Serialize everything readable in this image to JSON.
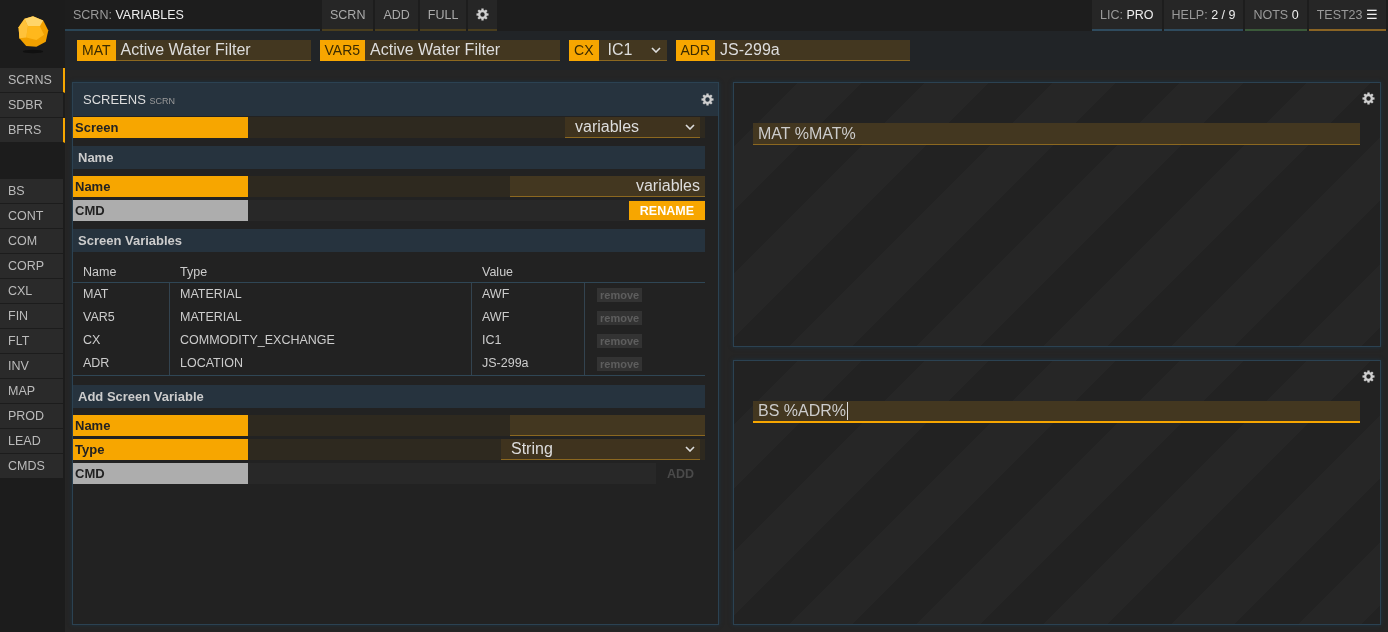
{
  "top_bar": {
    "screen_label": "SCRN:",
    "screen_name": "VARIABLES",
    "buttons": [
      {
        "label": "SCRN"
      },
      {
        "label": "ADD"
      },
      {
        "label": "FULL"
      }
    ],
    "status": [
      {
        "label": "LIC:",
        "value": "PRO",
        "color": "#2f4b5e"
      },
      {
        "label": "HELP:",
        "value": "2 / 9",
        "color": "#2f4b5e"
      },
      {
        "label": "NOTS",
        "value": "0",
        "color": "#3b5a3a"
      },
      {
        "label": "TEST23",
        "value": "☰",
        "color": "#8a6424"
      }
    ]
  },
  "context_fields": [
    {
      "kind": "input",
      "label": "MAT",
      "value": "Active Water Filter"
    },
    {
      "kind": "input",
      "label": "VAR5",
      "value": "Active Water Filter"
    },
    {
      "kind": "select",
      "label": "CX",
      "value": "IC1"
    },
    {
      "kind": "input",
      "label": "ADR",
      "value": "JS-299a"
    }
  ],
  "sidebar": {
    "groups": [
      {
        "items": [
          {
            "label": "SCRNS",
            "active": true
          },
          {
            "label": "SDBR",
            "active": false
          },
          {
            "label": "BFRS",
            "active": true
          }
        ]
      },
      {
        "items": [
          {
            "label": "BS",
            "active": false
          },
          {
            "label": "CONT",
            "active": false
          },
          {
            "label": "COM",
            "active": false
          },
          {
            "label": "CORP",
            "active": false
          },
          {
            "label": "CXL",
            "active": false
          },
          {
            "label": "FIN",
            "active": false
          },
          {
            "label": "FLT",
            "active": false
          },
          {
            "label": "INV",
            "active": false
          },
          {
            "label": "MAP",
            "active": false
          },
          {
            "label": "PROD",
            "active": false
          },
          {
            "label": "LEAD",
            "active": false
          },
          {
            "label": "CMDS",
            "active": false
          }
        ]
      }
    ]
  },
  "screens_panel": {
    "title": "SCREENS",
    "subtitle": "SCRN",
    "sections": [
      {
        "kind": "select",
        "label": "Screen",
        "value": "variables"
      },
      {
        "kind": "header",
        "text": "Name"
      },
      {
        "kind": "input",
        "label": "Name",
        "value": "variables"
      },
      {
        "kind": "command",
        "label": "CMD",
        "button": "RENAME",
        "disabled": false
      },
      {
        "kind": "header",
        "text": "Screen Variables"
      },
      {
        "kind": "table",
        "columns": [
          "Name",
          "Type",
          "Value"
        ],
        "rows": [
          {
            "cells": [
              "MAT",
              "MATERIAL",
              "AWF"
            ],
            "action": "remove"
          },
          {
            "cells": [
              "VAR5",
              "MATERIAL",
              "AWF"
            ],
            "action": "remove"
          },
          {
            "cells": [
              "CX",
              "COMMODITY_EXCHANGE",
              "IC1"
            ],
            "action": "remove"
          },
          {
            "cells": [
              "ADR",
              "LOCATION",
              "JS-299a"
            ],
            "action": "remove"
          }
        ]
      },
      {
        "kind": "header",
        "text": "Add Screen Variable"
      },
      {
        "kind": "input",
        "label": "Name"
      },
      {
        "kind": "select",
        "label": "Type",
        "value": "String"
      },
      {
        "kind": "command",
        "label": "CMD",
        "button": "ADD",
        "disabled": true
      }
    ]
  },
  "buffers": [
    {
      "command": "MAT %MAT%",
      "focused": false
    },
    {
      "command": "BS %ADR%",
      "focused": true
    }
  ]
}
